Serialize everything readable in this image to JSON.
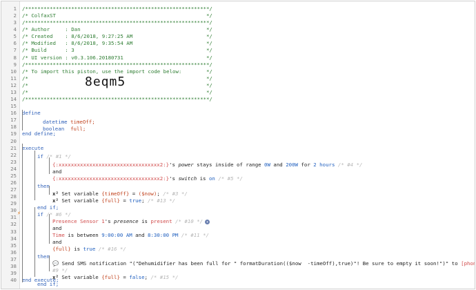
{
  "lines": [
    {
      "n": "1",
      "t": "/************************************************************/"
    },
    {
      "n": "2",
      "t": "/* ColfaxST                                                 */"
    },
    {
      "n": "3",
      "t": "/************************************************************/"
    },
    {
      "n": "4",
      "t": "/* Author     : Dan                                         */"
    },
    {
      "n": "5",
      "t": "/* Created    : 8/6/2018, 9:27:25 AM                        */"
    },
    {
      "n": "6",
      "t": "/* Modified   : 8/6/2018, 9:35:54 AM                        */"
    },
    {
      "n": "7",
      "t": "/* Build      : 3                                           */"
    },
    {
      "n": "8",
      "t": "/* UI version : v0.3.106.20180731                           */"
    },
    {
      "n": "9",
      "t": "/************************************************************/"
    },
    {
      "n": "10",
      "t": "/* To import this piston, use the import code below:        */"
    },
    {
      "n": "11",
      "t": "/*                                                          */"
    },
    {
      "n": "12",
      "t": "/*                                                          */"
    },
    {
      "n": "13",
      "t": "/*                                                          */"
    },
    {
      "n": "14",
      "t": "/************************************************************/"
    },
    {
      "n": "15",
      "t": ""
    },
    {
      "n": "16",
      "t": "define"
    },
    {
      "n": "17",
      "t": ""
    },
    {
      "n": "18",
      "t": ""
    },
    {
      "n": "19",
      "t": "end define;"
    },
    {
      "n": "20",
      "t": ""
    },
    {
      "n": "21",
      "t": "execute"
    },
    {
      "n": "22",
      "t": ""
    },
    {
      "n": "23",
      "t": ""
    },
    {
      "n": "24",
      "t": ""
    },
    {
      "n": "25",
      "t": ""
    },
    {
      "n": "26",
      "t": ""
    },
    {
      "n": "27",
      "t": ""
    },
    {
      "n": "28",
      "t": ""
    },
    {
      "n": "29",
      "t": ""
    },
    {
      "n": "30",
      "t": ""
    },
    {
      "n": "31",
      "t": ""
    },
    {
      "n": "32",
      "t": ""
    },
    {
      "n": "33",
      "t": ""
    },
    {
      "n": "34",
      "t": ""
    },
    {
      "n": "35",
      "t": ""
    },
    {
      "n": "36",
      "t": ""
    },
    {
      "n": "37",
      "t": ""
    },
    {
      "n": "38",
      "t": ""
    },
    {
      "n": "39",
      "t": ""
    },
    {
      "n": "40",
      "t": "end execute;"
    }
  ],
  "import_code": "8eqm5",
  "define": {
    "var1_type": "datetime",
    "var1_name": "timeOff;",
    "var2_type": "boolean",
    "var2_name": "full;"
  },
  "if1": {
    "kw": "if",
    "comment": "/* #1 */",
    "dev1": "{:xxxxxxxxxxxxxxxxxxxxxxxxxxxxxxxxx2:}",
    "cond1_a": "'s ",
    "cond1_attr": "power",
    "cond1_b": " stays inside of range ",
    "cond1_v1": "0W",
    "cond1_c": " and ",
    "cond1_v2": "200W",
    "cond1_d": " for ",
    "cond1_v3": "2 hours",
    "cond1_cmt": "/* #4 */",
    "and": "and",
    "dev2": "{:xxxxxxxxxxxxxxxxxxxxxxxxxxxxxxxxx2:}",
    "cond2_a": "'s ",
    "cond2_attr": "switch",
    "cond2_b": " is ",
    "cond2_v": "on",
    "cond2_cmt": "/* #5 */",
    "then": "then",
    "set1_pre": "Set variable ",
    "set1_var": "{timeOff}",
    "set1_eq": " = ",
    "set1_val": "($now)",
    "set1_end": ";",
    "set1_cmt": "/* #3 */",
    "set2_pre": "Set variable ",
    "set2_var": "{full}",
    "set2_eq": " = ",
    "set2_val": "true",
    "set2_end": ";",
    "set2_cmt": "/* #13 */",
    "endif": "end if;"
  },
  "if2": {
    "kw": "if",
    "comment": "/* #6 */",
    "c1_dev": "Presence Sensor 1",
    "c1_a": "'s ",
    "c1_attr": "presence",
    "c1_b": " is ",
    "c1_v": "present",
    "c1_cmt": "/* #10 */",
    "c1_badge": "✦",
    "and1": "and",
    "c2_a": "Time",
    "c2_b": " is between ",
    "c2_v1": "9:00:00 AM",
    "c2_c": " and ",
    "c2_v2": "8:30:00 PM",
    "c2_cmt": "/* #11 */",
    "and2": "and",
    "c3_var": "{full}",
    "c3_b": " is ",
    "c3_v": "true",
    "c3_cmt": "/* #16 */",
    "then": "then",
    "sms_icon": "💬",
    "sms_pre": "Send SMS notification ",
    "sms_str": "\"(\"Dehumidifier has been full for \" formatDuration(($now  -timeOff),true)\"! Be sure to empty it soon!\")\"",
    "sms_to": " to ",
    "sms_phone": "[phone number]",
    "sms_end": ";",
    "sms_cmt": "/*",
    "sms_cmt2": "#9 */",
    "set3_pre": "Set variable ",
    "set3_var": "{full}",
    "set3_eq": " = ",
    "set3_val": "false",
    "set3_end": ";",
    "set3_cmt": "/* #15 */",
    "endif": "end if;"
  },
  "bolt_icon": "⚡",
  "x2_icon": "x²",
  "colors": {
    "comment": "#2e7d32",
    "keyword": "#2d5fb8",
    "variable": "#c1441f",
    "device": "#d04848",
    "value": "#1f5fbf"
  }
}
